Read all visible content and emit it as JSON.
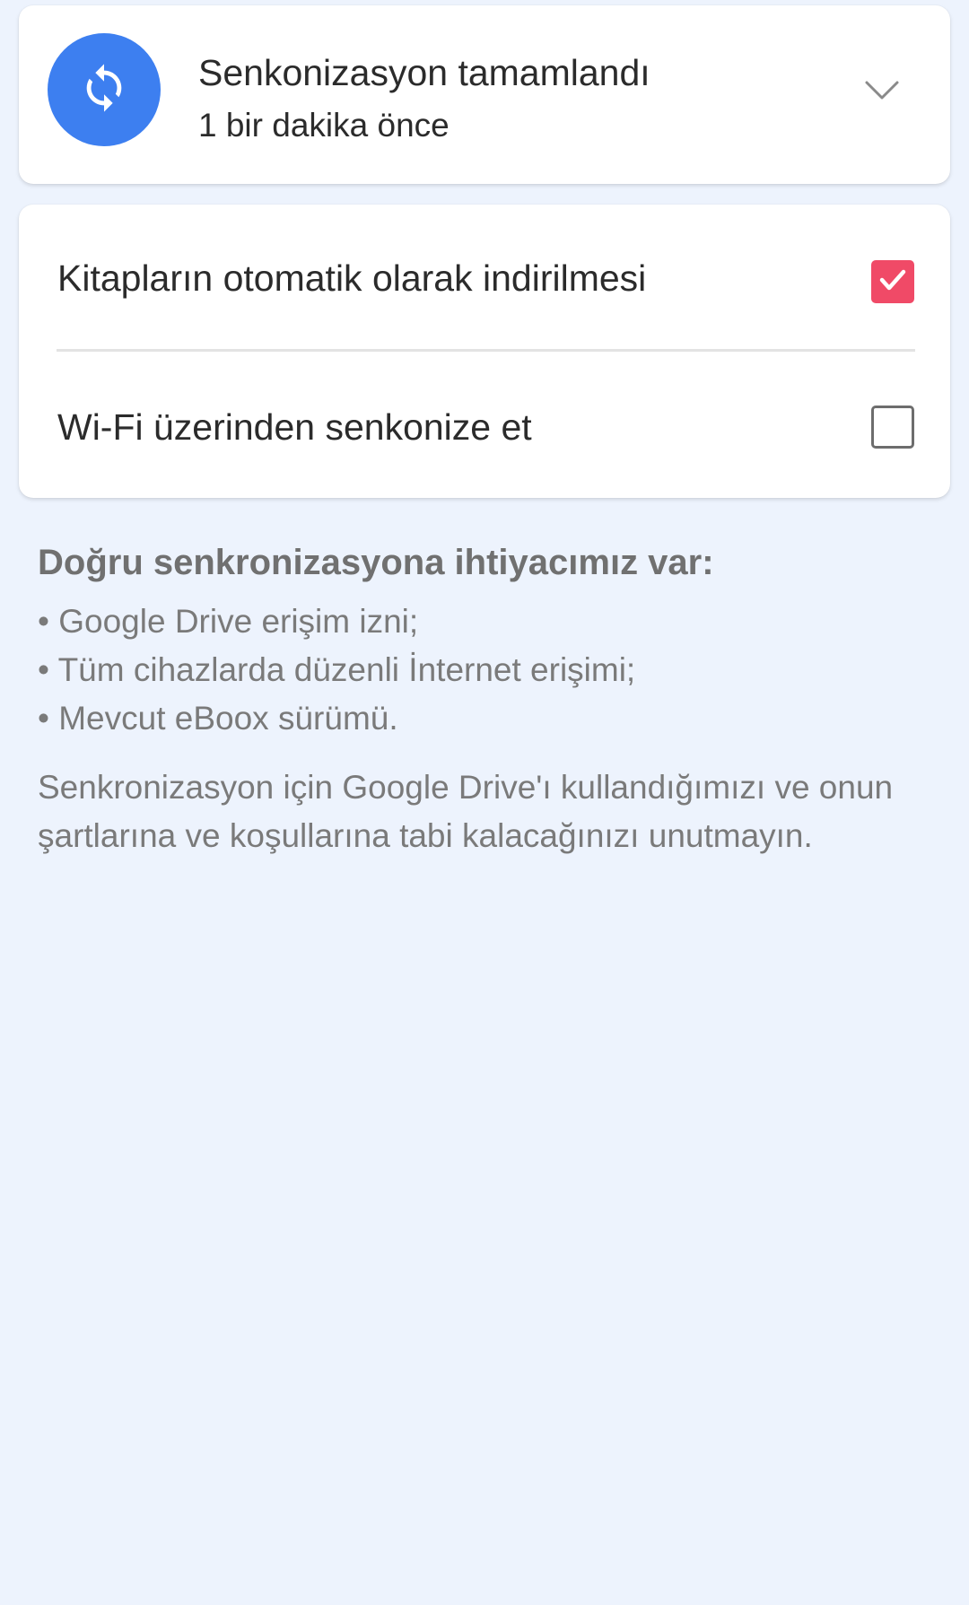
{
  "status": {
    "title": "Senkonizasyon tamamlandı",
    "subtitle": "1 bir dakika önce",
    "icon": "sync-icon",
    "icon_color": "#3d7ff0",
    "expand_icon": "chevron-down-icon"
  },
  "settings": {
    "auto_download": {
      "label": "Kitapların otomatik olarak indirilmesi",
      "checked": true,
      "checked_color": "#f04a67"
    },
    "wifi_sync": {
      "label": "Wi-Fi üzerinden senkonize et",
      "checked": false
    }
  },
  "info": {
    "title": "Doğru senkronizasyona ihtiyacımız var:",
    "bullets": [
      "• Google Drive erişim izni;",
      "• Tüm cihazlarda düzenli İnternet erişimi;",
      "• Mevcut eBoox sürümü."
    ],
    "note": "Senkronizasyon için Google Drive'ı kullandığımızı ve onun şartlarına ve koşullarına tabi kalacağınızı unutmayın."
  }
}
